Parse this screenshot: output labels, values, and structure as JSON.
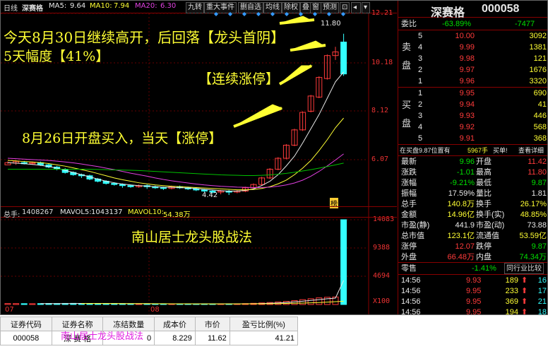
{
  "topbar": {
    "period": "日线",
    "stock": "深赛格",
    "ma5_label": "MA5:",
    "ma5": "9.64",
    "ma10_label": "MA10:",
    "ma10": "7.94",
    "ma20_label": "MA20:",
    "ma20": "6.30",
    "buttons": [
      "九转",
      "重大事件",
      "删自选",
      "均线",
      "除权",
      "叠",
      "窗",
      "预测"
    ]
  },
  "axis_prices": [
    "12.21",
    "10.18",
    "8.12",
    "6.07"
  ],
  "axis_vols": [
    "14083",
    "9388",
    "4694",
    "X100"
  ],
  "price_labels": {
    "high": "11.80",
    "low": "4.42",
    "limit_tag": "榜"
  },
  "volbar": {
    "total_label": "总手:",
    "total": "1408267",
    "mavol5_label": "MAVOL5:",
    "mavol5": "1043137",
    "mavol10_label": "MAVOL10:",
    "mavol10": "54.38万"
  },
  "dates": [
    "07",
    "08"
  ],
  "annotations": {
    "line1": "今天8月30日继续高开，后回落【龙头首阴】",
    "line2": "5天幅度【41%】",
    "line3": "【连续涨停】",
    "line4": "8月26日开盘买入，当天【涨停】",
    "line5": "南山居士龙头股战法"
  },
  "quote": {
    "name": "深赛格",
    "code": "000058",
    "weibi_label": "委比",
    "weibi": "-63.89%",
    "weicha": "-7477",
    "sell_label": [
      "卖",
      "盘"
    ],
    "buy_label": [
      "买",
      "盘"
    ],
    "sell": [
      {
        "lvl": "5",
        "price": "10.00",
        "vol": "3092"
      },
      {
        "lvl": "4",
        "price": "9.99",
        "vol": "1381"
      },
      {
        "lvl": "3",
        "price": "9.98",
        "vol": "121"
      },
      {
        "lvl": "2",
        "price": "9.97",
        "vol": "1676"
      },
      {
        "lvl": "1",
        "price": "9.96",
        "vol": "3320"
      }
    ],
    "buy": [
      {
        "lvl": "1",
        "price": "9.95",
        "vol": "690"
      },
      {
        "lvl": "2",
        "price": "9.94",
        "vol": "41"
      },
      {
        "lvl": "3",
        "price": "9.93",
        "vol": "446"
      },
      {
        "lvl": "4",
        "price": "9.92",
        "vol": "568"
      },
      {
        "lvl": "5",
        "price": "9.91",
        "vol": "368"
      }
    ],
    "buyline": {
      "label": "在买盘9.87位置有",
      "qty": "5967手",
      "tag": "买单!",
      "detail": "查看详细"
    },
    "stats": [
      {
        "l1": "最新",
        "v1": "9.96",
        "c1": "grn",
        "l2": "开盘",
        "v2": "11.42",
        "c2": "red"
      },
      {
        "l1": "涨跌",
        "v1": "-1.01",
        "c1": "grn",
        "l2": "最高",
        "v2": "11.80",
        "c2": "red"
      },
      {
        "l1": "涨幅",
        "v1": "-9.21%",
        "c1": "grn",
        "l2": "最低",
        "v2": "9.87",
        "c2": "grn"
      },
      {
        "l1": "振幅",
        "v1": "17.59%",
        "c1": "wht",
        "l2": "量比",
        "v2": "1.81",
        "c2": "wht"
      },
      {
        "l1": "总手",
        "v1": "140.8万",
        "c1": "yel",
        "l2": "换手",
        "v2": "26.17%",
        "c2": "yel"
      },
      {
        "l1": "金额",
        "v1": "14.96亿",
        "c1": "yel",
        "l2": "换手(实)",
        "v2": "48.85%",
        "c2": "yel"
      },
      {
        "l1": "市盈(静)",
        "v1": "441.9",
        "c1": "wht",
        "l2": "市盈(动)",
        "v2": "73.88",
        "c2": "wht"
      },
      {
        "l1": "总市值",
        "v1": "123.1亿",
        "c1": "yel",
        "l2": "流通值",
        "v2": "53.59亿",
        "c2": "yel"
      },
      {
        "l1": "涨停",
        "v1": "12.07",
        "c1": "red",
        "l2": "跌停",
        "v2": "9.87",
        "c2": "grn"
      },
      {
        "l1": "外盘",
        "v1": "66.48万",
        "c1": "red",
        "l2": "内盘",
        "v2": "74.34万",
        "c2": "grn"
      }
    ],
    "tick_label": "零售",
    "tick_pct": "-1.41%",
    "tick_btn": "同行业比较",
    "ticks": [
      {
        "t": "14:56",
        "p": "9.93",
        "v": "189",
        "d": "up",
        "n": "16"
      },
      {
        "t": "14:56",
        "p": "9.95",
        "v": "233",
        "d": "up",
        "n": "17"
      },
      {
        "t": "14:56",
        "p": "9.95",
        "v": "369",
        "d": "up",
        "n": "21"
      },
      {
        "t": "14:56",
        "p": "9.95",
        "v": "194",
        "d": "up",
        "n": "18"
      }
    ]
  },
  "grid": {
    "headers": [
      "证券代码",
      "证券名称",
      "冻结数量",
      "成本价",
      "市价",
      "盈亏比例(%)"
    ],
    "row": [
      "000058",
      "深 赛 格",
      "0",
      "8.229",
      "11.62",
      "41.21"
    ],
    "overlay": "南山居士龙头股战法"
  },
  "colors": {
    "up": "#ff3b3b",
    "down": "#33ffff",
    "ma5": "#e8e8e8",
    "ma10": "#ffff33",
    "ma20": "#e040e0",
    "ma60": "#00c000"
  },
  "chart_data": {
    "type": "candlestick",
    "y_range": [
      4.0,
      12.6
    ],
    "candles": [
      [
        5.8,
        5.9,
        5.85,
        5.95
      ],
      [
        5.88,
        5.95,
        5.8,
        6.0
      ],
      [
        5.9,
        5.85,
        5.82,
        5.98
      ],
      [
        5.85,
        5.9,
        5.8,
        5.95
      ],
      [
        5.9,
        5.8,
        5.75,
        5.95
      ],
      [
        5.8,
        5.7,
        5.65,
        5.85
      ],
      [
        5.7,
        5.6,
        5.55,
        5.75
      ],
      [
        5.6,
        5.45,
        5.4,
        5.65
      ],
      [
        5.45,
        5.35,
        5.3,
        5.5
      ],
      [
        5.35,
        5.3,
        5.2,
        5.4
      ],
      [
        5.3,
        5.15,
        5.1,
        5.35
      ],
      [
        5.15,
        5.05,
        5.0,
        5.2
      ],
      [
        5.05,
        4.95,
        4.9,
        5.1
      ],
      [
        4.95,
        4.9,
        4.85,
        5.0
      ],
      [
        4.9,
        4.85,
        4.75,
        4.95
      ],
      [
        4.85,
        4.8,
        4.75,
        4.9
      ],
      [
        4.8,
        4.85,
        4.75,
        4.9
      ],
      [
        4.85,
        4.8,
        4.7,
        4.9
      ],
      [
        4.8,
        4.75,
        4.7,
        4.85
      ],
      [
        4.75,
        4.72,
        4.65,
        4.8
      ],
      [
        4.72,
        4.8,
        4.68,
        4.85
      ],
      [
        4.8,
        4.75,
        4.7,
        4.85
      ],
      [
        4.75,
        4.7,
        4.65,
        4.8
      ],
      [
        4.7,
        4.65,
        4.6,
        4.75
      ],
      [
        4.65,
        4.6,
        4.55,
        4.7
      ],
      [
        4.6,
        4.55,
        4.5,
        4.65
      ],
      [
        4.55,
        4.6,
        4.45,
        4.65
      ],
      [
        4.6,
        4.55,
        4.42,
        4.65
      ],
      [
        4.55,
        4.6,
        4.5,
        4.65
      ],
      [
        4.6,
        4.75,
        4.55,
        4.8
      ],
      [
        4.75,
        4.9,
        4.7,
        4.95
      ],
      [
        4.9,
        5.2,
        4.85,
        5.25
      ],
      [
        5.2,
        5.6,
        5.15,
        5.65
      ],
      [
        5.6,
        6.1,
        5.55,
        6.15
      ],
      [
        6.1,
        6.7,
        6.05,
        6.75
      ],
      [
        6.7,
        7.4,
        6.65,
        7.45
      ],
      [
        7.4,
        8.2,
        7.35,
        8.25
      ],
      [
        8.25,
        8.95,
        8.2,
        9.0
      ],
      [
        8.9,
        9.8,
        8.85,
        9.85
      ],
      [
        9.75,
        10.8,
        9.7,
        10.85
      ],
      [
        10.8,
        10.97,
        10.6,
        11.2
      ],
      [
        11.42,
        9.96,
        9.87,
        11.8
      ]
    ],
    "ma5": [
      5.9,
      5.88,
      5.85,
      5.82,
      5.78,
      5.72,
      5.65,
      5.55,
      5.45,
      5.35,
      5.25,
      5.15,
      5.05,
      4.98,
      4.92,
      4.88,
      4.85,
      4.83,
      4.8,
      4.78,
      4.77,
      4.76,
      4.74,
      4.72,
      4.68,
      4.65,
      4.62,
      4.6,
      4.6,
      4.63,
      4.7,
      4.85,
      5.05,
      5.35,
      5.75,
      6.2,
      6.8,
      7.45,
      8.1,
      8.85,
      9.6,
      10.05
    ],
    "ma10": [
      6.0,
      5.98,
      5.95,
      5.93,
      5.9,
      5.86,
      5.8,
      5.74,
      5.66,
      5.58,
      5.5,
      5.4,
      5.3,
      5.2,
      5.12,
      5.05,
      4.98,
      4.93,
      4.88,
      4.85,
      4.82,
      4.8,
      4.78,
      4.76,
      4.74,
      4.72,
      4.7,
      4.68,
      4.66,
      4.66,
      4.67,
      4.72,
      4.8,
      4.93,
      5.1,
      5.35,
      5.65,
      6.0,
      6.45,
      6.95,
      7.5,
      7.94
    ],
    "ma20": [
      6.1,
      6.08,
      6.06,
      6.04,
      6.02,
      6.0,
      5.97,
      5.93,
      5.89,
      5.84,
      5.78,
      5.72,
      5.65,
      5.58,
      5.5,
      5.42,
      5.35,
      5.28,
      5.2,
      5.13,
      5.07,
      5.02,
      4.97,
      4.92,
      4.88,
      4.85,
      4.82,
      4.8,
      4.78,
      4.77,
      4.76,
      4.76,
      4.78,
      4.82,
      4.88,
      4.97,
      5.1,
      5.28,
      5.5,
      5.75,
      6.02,
      6.3
    ],
    "ma60": [
      5.6,
      5.6,
      5.6,
      5.6,
      5.6,
      5.6,
      5.6,
      5.6,
      5.6,
      5.6,
      5.6,
      5.59,
      5.58,
      5.57,
      5.56,
      5.55,
      5.54,
      5.52,
      5.5,
      5.48,
      5.46,
      5.44,
      5.42,
      5.4,
      5.38,
      5.36,
      5.34,
      5.33,
      5.32,
      5.31,
      5.31,
      5.32,
      5.34,
      5.37,
      5.41,
      5.46,
      5.52,
      5.58,
      5.65,
      5.72,
      5.8,
      5.88
    ],
    "vol_range": [
      0,
      14083
    ],
    "volumes": [
      160,
      150,
      140,
      130,
      150,
      170,
      160,
      180,
      190,
      170,
      160,
      150,
      140,
      150,
      130,
      120,
      120,
      110,
      110,
      100,
      110,
      100,
      100,
      90,
      100,
      100,
      110,
      110,
      120,
      150,
      200,
      260,
      330,
      420,
      520,
      650,
      800,
      950,
      1100,
      1200,
      1250,
      14083
    ],
    "vol_ma5": [
      null,
      null,
      null,
      null,
      146,
      150,
      150,
      154,
      162,
      174,
      172,
      170,
      162,
      154,
      146,
      138,
      132,
      126,
      118,
      112,
      110,
      106,
      104,
      100,
      100,
      98,
      100,
      102,
      106,
      118,
      138,
      168,
      202,
      252,
      316,
      436,
      544,
      668,
      808,
      960,
      1059,
      4000
    ],
    "vol_ma10": [
      null,
      null,
      null,
      null,
      null,
      null,
      null,
      null,
      null,
      160,
      160,
      160,
      158,
      155,
      152,
      148,
      146,
      140,
      132,
      125,
      120,
      116,
      112,
      108,
      105,
      102,
      101,
      100,
      101,
      106,
      112,
      121,
      135,
      152,
      172,
      200,
      232,
      275,
      330,
      400,
      470,
      547
    ]
  }
}
